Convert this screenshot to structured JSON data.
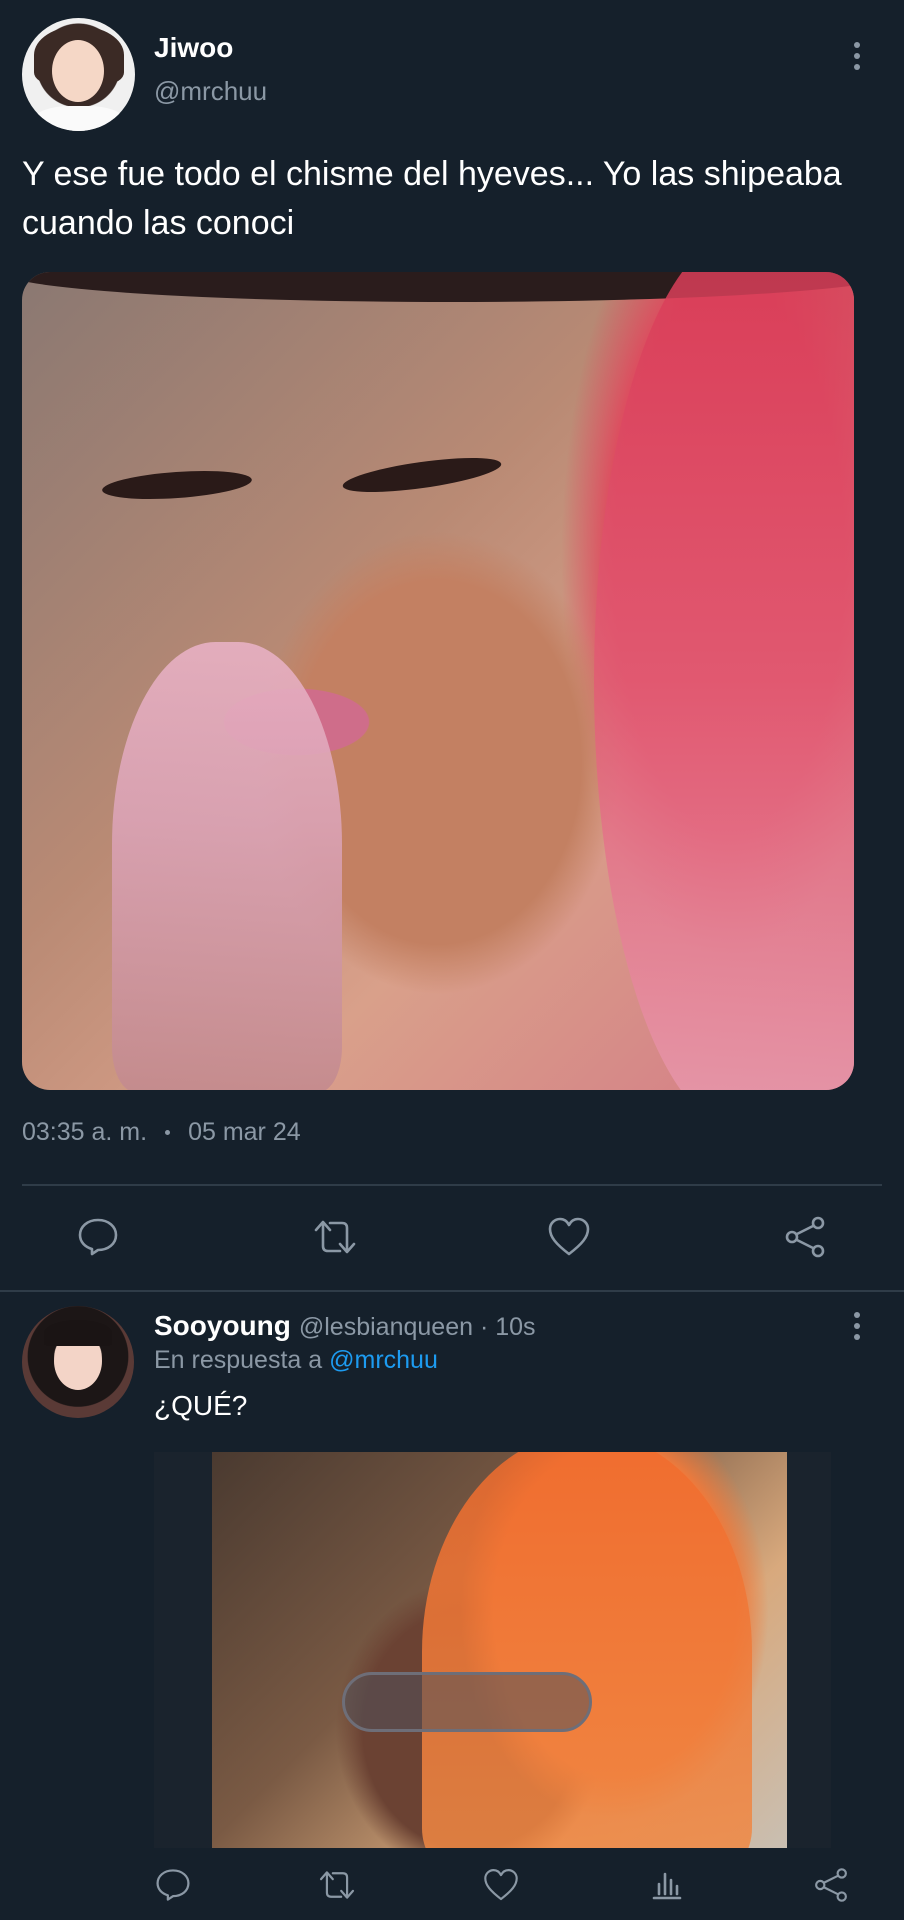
{
  "main_tweet": {
    "display_name": "Jiwoo",
    "handle": "@mrchuu",
    "text": "Y ese fue todo el chisme del hyeves... Yo las shipeaba cuando las conoci",
    "time": "03:35 a. m.",
    "date": "05 mar 24",
    "actions": [
      "reply-icon",
      "retweet-icon",
      "like-icon",
      "share-icon"
    ]
  },
  "reply_tweet": {
    "display_name": "Sooyoung",
    "handle_time": "@lesbianqueen · 10s",
    "reply_prefix": "En respuesta a",
    "reply_mention": "@mrchuu",
    "text": "¿QUÉ?",
    "actions": [
      "reply-icon",
      "retweet-icon",
      "like-icon",
      "views-icon",
      "share-icon"
    ]
  },
  "colors": {
    "background": "#15202b",
    "secondary_text": "#8b98a5",
    "mention": "#1d9bf0",
    "divider": "#2f3c48"
  }
}
